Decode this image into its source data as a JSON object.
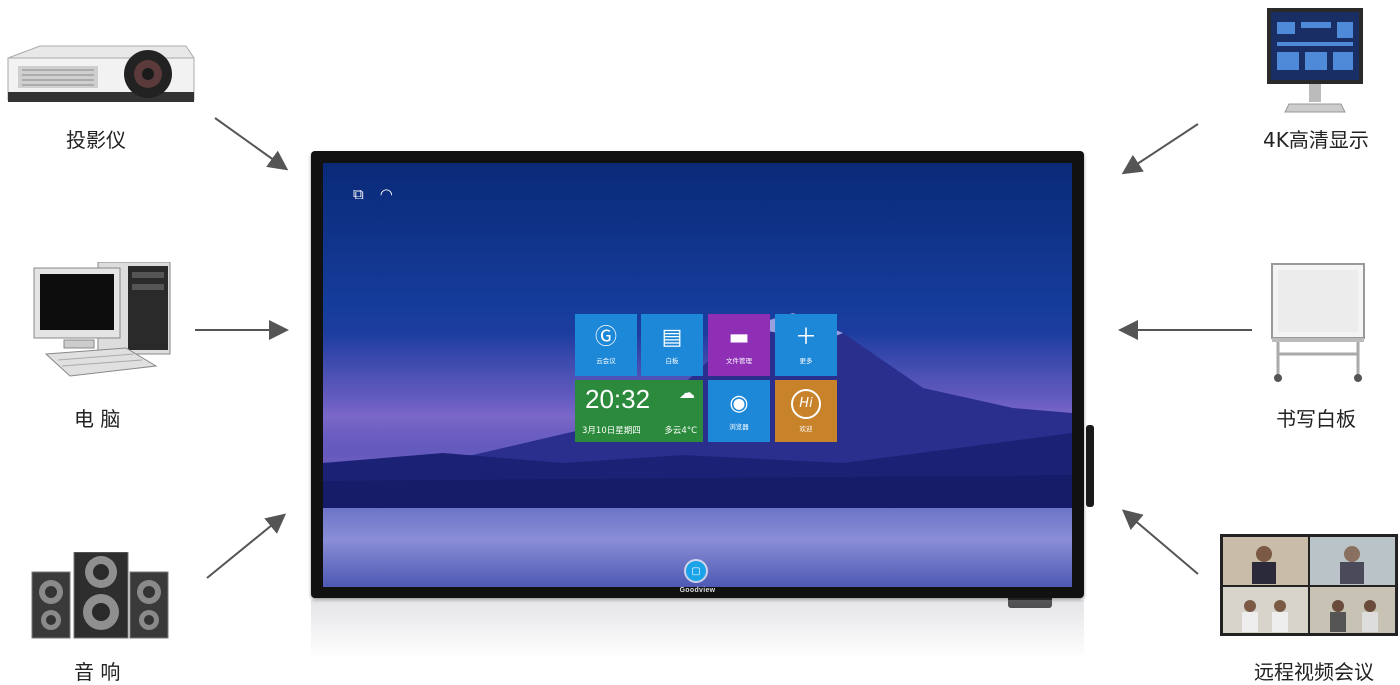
{
  "devices": {
    "projector": {
      "label": "投影仪",
      "icon": "projector-icon"
    },
    "computer": {
      "label": "电 脑",
      "icon": "computer-icon"
    },
    "speaker": {
      "label": "音 响",
      "icon": "speaker-icon"
    },
    "monitor_4k": {
      "label": "4K高清显示",
      "icon": "monitor-icon"
    },
    "whiteboard": {
      "label": "书写白板",
      "icon": "whiteboard-icon"
    },
    "video_conference": {
      "label": "远程视频会议",
      "icon": "video-conference-icon"
    }
  },
  "screen": {
    "status_icons": [
      "screen-mirror-icon",
      "wifi-icon"
    ],
    "tiles": [
      {
        "label": "云会议",
        "icon": "cloud-meeting-icon",
        "color": "#1e88d8"
      },
      {
        "label": "白板",
        "icon": "whiteboard-app-icon",
        "color": "#1e88d8"
      },
      {
        "label": "文件管理",
        "icon": "folder-icon",
        "color": "#8e2fb6"
      },
      {
        "label": "更多",
        "icon": "plus-icon",
        "color": "#1e88d8"
      },
      {
        "label": "浏览器",
        "icon": "browser-icon",
        "color": "#1e88d8"
      },
      {
        "label": "欢迎",
        "icon": "hi-icon",
        "color": "#c8832a"
      }
    ],
    "clock": {
      "time": "20:32",
      "date": "3月10日星期四",
      "weather": "多云4°C"
    },
    "brand": "Goodview"
  }
}
